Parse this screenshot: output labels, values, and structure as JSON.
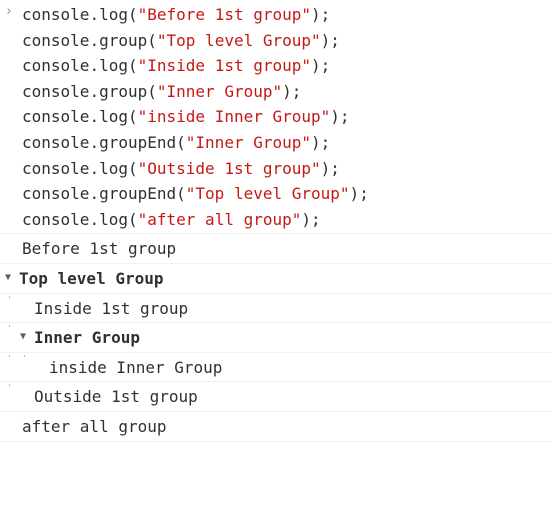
{
  "prompt_marker": "›",
  "disclosure_open": "▼",
  "code": {
    "lines": [
      {
        "obj": "console",
        "method": "log",
        "arg": "\"Before 1st group\""
      },
      {
        "obj": "console",
        "method": "group",
        "arg": "\"Top level Group\""
      },
      {
        "obj": "console",
        "method": "log",
        "arg": "\"Inside 1st group\""
      },
      {
        "obj": "console",
        "method": "group",
        "arg": "\"Inner Group\""
      },
      {
        "obj": "console",
        "method": "log",
        "arg": "\"inside Inner Group\""
      },
      {
        "obj": "console",
        "method": "groupEnd",
        "arg": "\"Inner Group\""
      },
      {
        "obj": "console",
        "method": "log",
        "arg": "\"Outside 1st group\""
      },
      {
        "obj": "console",
        "method": "groupEnd",
        "arg": "\"Top level Group\""
      },
      {
        "obj": "console",
        "method": "log",
        "arg": "\"after all group\""
      }
    ]
  },
  "output": {
    "before": "Before 1st group",
    "top_group": "Top level Group",
    "inside_1st": "Inside 1st group",
    "inner_group": "Inner Group",
    "inside_inner": "inside Inner Group",
    "outside_1st": "Outside 1st group",
    "after_all": "after all group"
  }
}
